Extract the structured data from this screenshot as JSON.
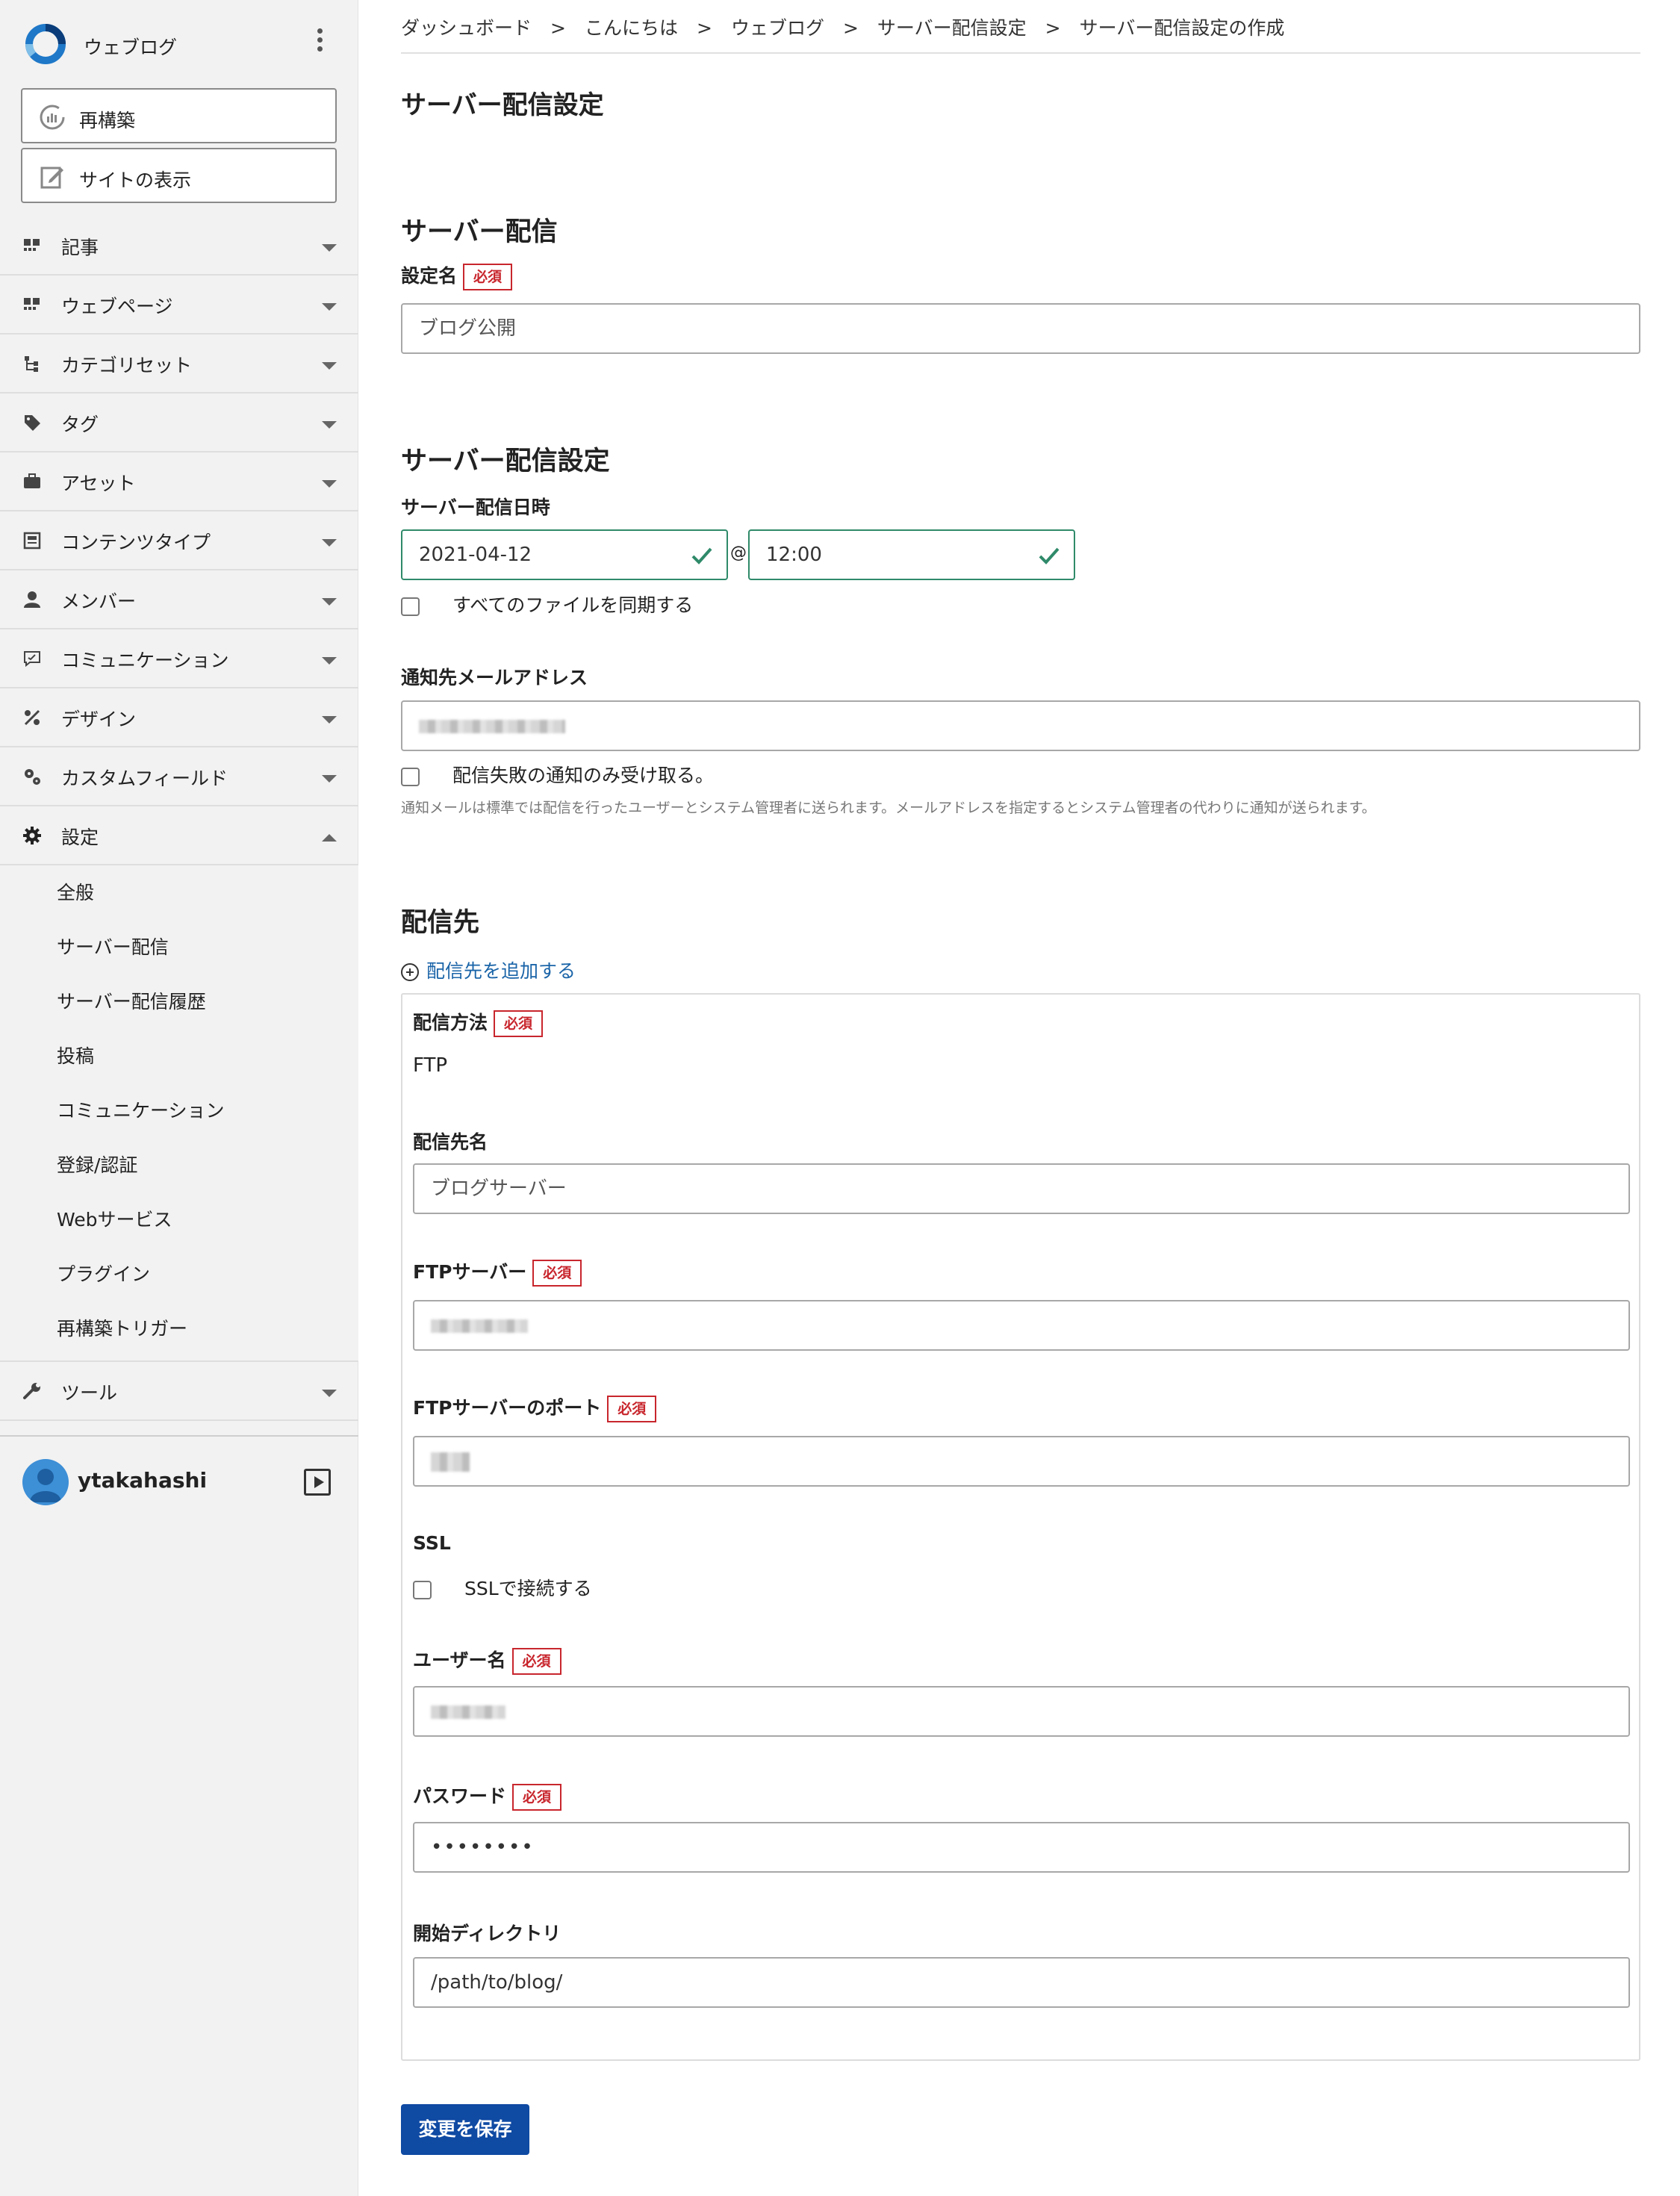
{
  "sidebar": {
    "site_name": "ウェブログ",
    "rebuild_label": "再構築",
    "view_site_label": "サイトの表示",
    "items": [
      {
        "label": "記事",
        "icon": "entries-icon"
      },
      {
        "label": "ウェブページ",
        "icon": "pages-icon"
      },
      {
        "label": "カテゴリセット",
        "icon": "category-set-icon"
      },
      {
        "label": "タグ",
        "icon": "tag-icon"
      },
      {
        "label": "アセット",
        "icon": "asset-icon"
      },
      {
        "label": "コンテンツタイプ",
        "icon": "content-type-icon"
      },
      {
        "label": "メンバー",
        "icon": "member-icon"
      },
      {
        "label": "コミュニケーション",
        "icon": "communication-icon"
      },
      {
        "label": "デザイン",
        "icon": "design-icon"
      },
      {
        "label": "カスタムフィールド",
        "icon": "custom-field-icon"
      },
      {
        "label": "設定",
        "icon": "gear-icon"
      },
      {
        "label": "ツール",
        "icon": "wrench-icon"
      }
    ],
    "settings_sub": [
      "全般",
      "サーバー配信",
      "サーバー配信履歴",
      "投稿",
      "コミュニケーション",
      "登録/認証",
      "Webサービス",
      "プラグイン",
      "再構築トリガー"
    ],
    "username": "ytakahashi"
  },
  "breadcrumb": [
    "ダッシュボード",
    "こんにちは",
    "ウェブログ",
    "サーバー配信設定",
    "サーバー配信設定の作成"
  ],
  "breadcrumb_sep": ">",
  "page_title": "サーバー配信設定",
  "section_server": {
    "heading": "サーバー配信",
    "name_label": "設定名",
    "required": "必須",
    "name_placeholder": "ブログ公開"
  },
  "section_settings": {
    "heading": "サーバー配信設定",
    "datetime_label": "サーバー配信日時",
    "date_value": "2021-04-12",
    "at": "@",
    "time_value": "12:00",
    "sync_all_label": "すべてのファイルを同期する",
    "email_label": "通知先メールアドレス",
    "failure_only_label": "配信失敗の通知のみ受け取る。",
    "hint": "通知メールは標準では配信を行ったユーザーとシステム管理者に送られます。メールアドレスを指定するとシステム管理者の代わりに通知が送られます。"
  },
  "section_dest": {
    "heading": "配信先",
    "add_link": "配信先を追加する",
    "method_label": "配信方法",
    "method_value": "FTP",
    "dest_name_label": "配信先名",
    "dest_name_placeholder": "ブログサーバー",
    "ftp_server_label": "FTPサーバー",
    "ftp_port_label": "FTPサーバーのポート",
    "ssl_label": "SSL",
    "ssl_checkbox_label": "SSLで接続する",
    "username_label": "ユーザー名",
    "password_label": "パスワード",
    "password_value": "••••••••",
    "start_dir_label": "開始ディレクトリ",
    "start_dir_value": "/path/to/blog/"
  },
  "save_label": "変更を保存",
  "colors": {
    "accent": "#0f4aa3",
    "required": "#c8262d",
    "link": "#1a64a8",
    "valid": "#2f8a6a"
  }
}
